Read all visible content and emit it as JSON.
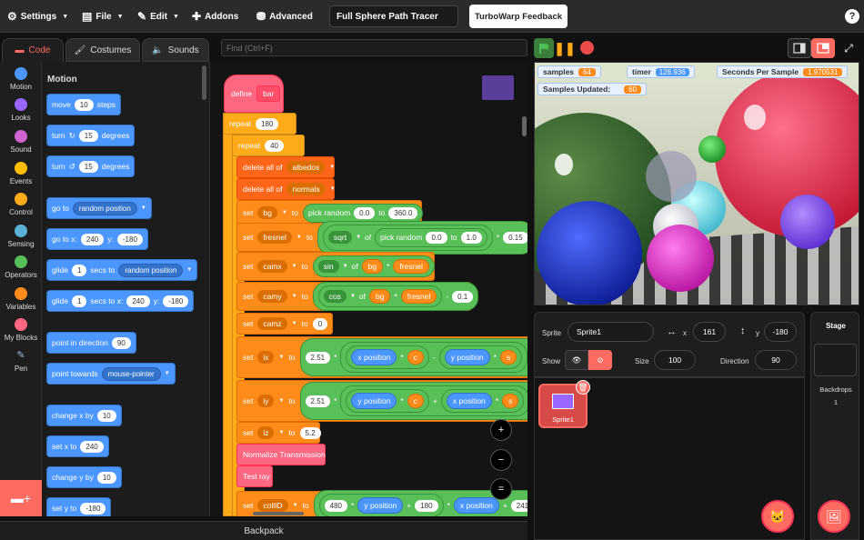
{
  "menu": {
    "settings": "Settings",
    "file": "File",
    "edit": "Edit",
    "addons": "Addons",
    "advanced": "Advanced",
    "project_title": "Full Sphere Path Tracer",
    "feedback": "TurboWarp Feedback",
    "help": "?"
  },
  "tabs": {
    "code": "Code",
    "costumes": "Costumes",
    "sounds": "Sounds"
  },
  "find": {
    "placeholder": "Find (Ctrl+F)"
  },
  "categories": [
    {
      "label": "Motion",
      "color": "#4c97ff"
    },
    {
      "label": "Looks",
      "color": "#9966ff"
    },
    {
      "label": "Sound",
      "color": "#cf63cf"
    },
    {
      "label": "Events",
      "color": "#ffbf00"
    },
    {
      "label": "Control",
      "color": "#ffab19"
    },
    {
      "label": "Sensing",
      "color": "#5cb1d6"
    },
    {
      "label": "Operators",
      "color": "#59c059"
    },
    {
      "label": "Variables",
      "color": "#ff8c1a"
    },
    {
      "label": "My Blocks",
      "color": "#ff6680"
    },
    {
      "label": "Pen",
      "color": "#0fbd8c"
    }
  ],
  "palette": {
    "heading": "Motion",
    "move": {
      "a": "move",
      "v": "10",
      "b": "steps"
    },
    "turn_right": {
      "a": "turn",
      "v": "15",
      "b": "degrees"
    },
    "turn_left": {
      "a": "turn",
      "v": "15",
      "b": "degrees"
    },
    "goto": {
      "a": "go to",
      "d": "random position"
    },
    "goto_xy": {
      "a": "go to x:",
      "x": "240",
      "b": "y:",
      "y": "-180"
    },
    "glide": {
      "a": "glide",
      "v": "1",
      "b": "secs to",
      "d": "random position"
    },
    "glide_xy": {
      "a": "glide",
      "v": "1",
      "b": "secs to x:",
      "x": "240",
      "c": "y:",
      "y": "-180"
    },
    "point_dir": {
      "a": "point in direction",
      "v": "90"
    },
    "point_towards": {
      "a": "point towards",
      "d": "mouse-pointer"
    },
    "change_x": {
      "a": "change x by",
      "v": "10"
    },
    "set_x": {
      "a": "set x to",
      "v": "240"
    },
    "change_y": {
      "a": "change y by",
      "v": "10"
    },
    "set_y": {
      "a": "set y to",
      "v": "-180"
    }
  },
  "script": {
    "define": "define",
    "define_name": "bar",
    "repeat1": {
      "label": "repeat",
      "v": "180"
    },
    "repeat2": {
      "label": "repeat",
      "v": "40"
    },
    "delete1": {
      "a": "delete all of",
      "d": "albedos"
    },
    "delete2": {
      "a": "delete all of",
      "d": "normals"
    },
    "set_bg": {
      "set": "set",
      "var": "bg",
      "to": "to",
      "op": "pick random",
      "a": "0.0",
      "b": "to",
      "c": "360.0"
    },
    "set_fresnel": {
      "set": "set",
      "var": "fresnel",
      "to": "to",
      "fn": "sqrt",
      "of": "of",
      "op": "pick random",
      "a": "0.0",
      "b": "to",
      "c": "1.0",
      "star": "*",
      "m": "0.15"
    },
    "set_camx": {
      "set": "set",
      "var": "camx",
      "to": "to",
      "fn": "sin",
      "of": "of",
      "v1": "bg",
      "star": "*",
      "v2": "fresnel"
    },
    "set_camy": {
      "set": "set",
      "var": "camy",
      "to": "to",
      "fn": "cos",
      "of": "of",
      "v1": "bg",
      "star": "*",
      "v2": "fresnel",
      "minus": "-",
      "m": "0.1"
    },
    "set_camz": {
      "set": "set",
      "var": "camz",
      "to": "to",
      "v": "0"
    },
    "set_ix": {
      "set": "set",
      "var": "ix",
      "to": "to",
      "n": "2.51",
      "star": "*",
      "p1": "x position",
      "st2": "*",
      "c": "c",
      "minus": "-",
      "p2": "y position",
      "st3": "*",
      "s": "s",
      "plus": "+"
    },
    "set_iy": {
      "set": "set",
      "var": "iy",
      "to": "to",
      "n": "2.51",
      "star": "*",
      "p1": "y position",
      "st2": "*",
      "c": "c",
      "plus": "+",
      "p2": "x position",
      "st3": "*",
      "s": "s",
      "plus2": "+"
    },
    "set_iz": {
      "set": "set",
      "var": "iz",
      "to": "to",
      "v": "5.2"
    },
    "normalize": "Normalize Transmission",
    "test_ray": "Test ray",
    "set_collid": {
      "set": "set",
      "var": "collID",
      "to": "to",
      "n": "480",
      "star": "*",
      "p1": "y position",
      "plus": "+",
      "v": "180",
      "st2": "*",
      "p2": "x position",
      "plus2": "+",
      "v2": "241"
    }
  },
  "zoom": {
    "zoom_in": "+",
    "zoom_out": "−",
    "reset": "="
  },
  "backpack": "Backpack",
  "monitors": {
    "samples": {
      "label": "samples",
      "value": "64"
    },
    "timer": {
      "label": "timer",
      "value": "126.936"
    },
    "sps": {
      "label": "Seconds Per Sample",
      "value": "1.970531"
    },
    "updated": {
      "label": "Samples Updated:",
      "value": "60"
    }
  },
  "sprite_info": {
    "sprite_label": "Sprite",
    "sprite_name": "Sprite1",
    "x_label": "x",
    "x": "161",
    "y_label": "y",
    "y": "-180",
    "show_label": "Show",
    "size_label": "Size",
    "size": "100",
    "direction_label": "Direction",
    "direction": "90"
  },
  "sprites": [
    {
      "name": "Sprite1"
    }
  ],
  "stage_panel": {
    "title": "Stage",
    "backdrops_label": "Backdrops",
    "backdrops_count": "1"
  },
  "colors": {
    "accent": "#ff6b60",
    "motion": "#4c97ff",
    "control": "#ffab19",
    "variables": "#ff8c1a",
    "operators": "#59c059"
  }
}
